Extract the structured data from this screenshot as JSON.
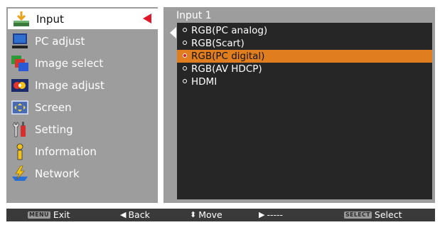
{
  "menu": {
    "items": [
      {
        "label": "Input",
        "icon": "input-icon"
      },
      {
        "label": "PC adjust",
        "icon": "pc-adjust-icon"
      },
      {
        "label": "Image select",
        "icon": "image-select-icon"
      },
      {
        "label": "Image adjust",
        "icon": "image-adjust-icon"
      },
      {
        "label": "Screen",
        "icon": "screen-icon"
      },
      {
        "label": "Setting",
        "icon": "setting-icon"
      },
      {
        "label": "Information",
        "icon": "information-icon"
      },
      {
        "label": "Network",
        "icon": "network-icon"
      }
    ],
    "selected_index": 0
  },
  "submenu": {
    "title": "Input 1",
    "options": [
      {
        "label": "RGB(PC analog)"
      },
      {
        "label": "RGB(Scart)"
      },
      {
        "label": "RGB(PC digital)"
      },
      {
        "label": "RGB(AV HDCP)"
      },
      {
        "label": "HDMI"
      }
    ],
    "selected_index": 2
  },
  "help_bar": {
    "exit_key": "MENU",
    "exit_label": "Exit",
    "back_label": "Back",
    "move_label": "Move",
    "next_label": "-----",
    "select_key": "SELECT",
    "select_label": "Select"
  },
  "colors": {
    "panel_gray": "#9d9d9d",
    "sub_panel": "#262626",
    "highlight_orange": "#e07e1f",
    "accent_red": "#e0162b",
    "help_bar": "#3a3a3a"
  }
}
